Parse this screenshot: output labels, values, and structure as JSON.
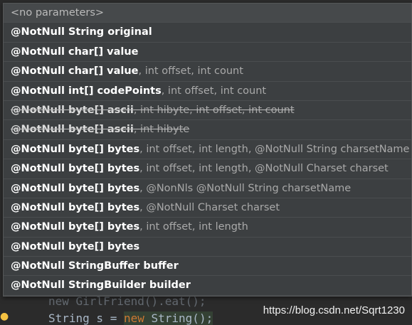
{
  "popup": {
    "header": "<no parameters>",
    "items": [
      {
        "bold": "@NotNull String original",
        "rest": "",
        "deprecated": false
      },
      {
        "bold": "@NotNull char[] value",
        "rest": "",
        "deprecated": false
      },
      {
        "bold": "@NotNull char[] value",
        "rest": ", int offset, int count",
        "deprecated": false
      },
      {
        "bold": "@NotNull int[] codePoints",
        "rest": ", int offset, int count",
        "deprecated": false
      },
      {
        "bold": "@NotNull byte[] ascii",
        "rest": ", int hibyte, int offset, int count",
        "deprecated": true
      },
      {
        "bold": "@NotNull byte[] ascii",
        "rest": ", int hibyte",
        "deprecated": true
      },
      {
        "bold": "@NotNull byte[] bytes",
        "rest": ", int offset, int length, @NotNull String charsetName",
        "deprecated": false
      },
      {
        "bold": "@NotNull byte[] bytes",
        "rest": ", int offset, int length, @NotNull Charset charset",
        "deprecated": false
      },
      {
        "bold": "@NotNull byte[] bytes",
        "rest": ", @NonNls @NotNull String charsetName",
        "deprecated": false
      },
      {
        "bold": "@NotNull byte[] bytes",
        "rest": ", @NotNull Charset charset",
        "deprecated": false
      },
      {
        "bold": "@NotNull byte[] bytes",
        "rest": ", int offset, int length",
        "deprecated": false
      },
      {
        "bold": "@NotNull byte[] bytes",
        "rest": "",
        "deprecated": false
      },
      {
        "bold": "@NotNull StringBuffer buffer",
        "rest": "",
        "deprecated": false
      },
      {
        "bold": "@NotNull StringBuilder builder",
        "rest": "",
        "deprecated": false
      }
    ]
  },
  "editor": {
    "line1": "new GirlFriend().eat();",
    "line2_a": "String s = ",
    "line2_kw": "new",
    "line2_b": " String();"
  },
  "watermark": "https://blog.csdn.net/Sqrt1230"
}
